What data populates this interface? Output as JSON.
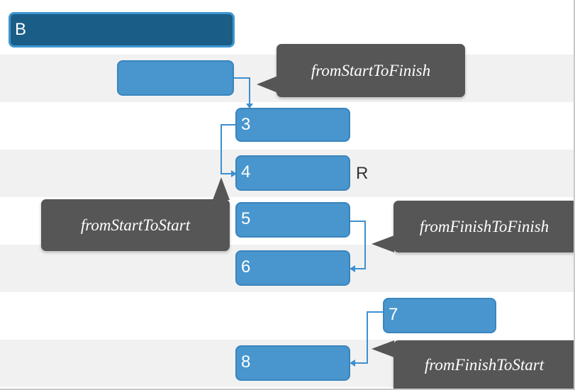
{
  "tasks": {
    "b": {
      "label": "B"
    },
    "unnamed": {
      "label": ""
    },
    "t3": {
      "label": "3"
    },
    "t4": {
      "label": "4",
      "flag": "R"
    },
    "t5": {
      "label": "5"
    },
    "t6": {
      "label": "6"
    },
    "t7": {
      "label": "7"
    },
    "t8": {
      "label": "8"
    }
  },
  "callouts": {
    "start_to_finish": "fromStartToFinish",
    "start_to_start": "fromStartToStart",
    "finish_to_finish": "fromFinishToFinish",
    "finish_to_start": "fromFinishToStart"
  },
  "colors": {
    "task_fill": "#4896cd",
    "parent_fill": "#1a5d87",
    "link_line": "#3d8fd0",
    "callout_fill": "#565656",
    "row_shade": "#f1f1f1"
  }
}
